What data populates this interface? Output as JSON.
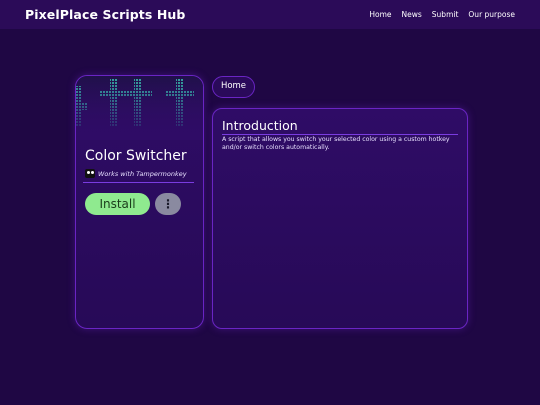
{
  "header": {
    "brand": "PixelPlace Scripts Hub",
    "nav": [
      "Home",
      "News",
      "Submit",
      "Our purpose"
    ]
  },
  "script_card": {
    "title": "Color Switcher",
    "compat": "Works with Tampermonkey",
    "install_label": "Install",
    "more_icon": "⋮"
  },
  "tabs": {
    "home": "Home"
  },
  "intro": {
    "heading": "Introduction",
    "description": "A script that allows you switch your selected color using a custom hotkey and/or switch colors automatically."
  },
  "colors": {
    "background": "#1f0744",
    "panel": "#2f0c66",
    "accent": "#6a25c4",
    "install": "#8fea8f"
  }
}
